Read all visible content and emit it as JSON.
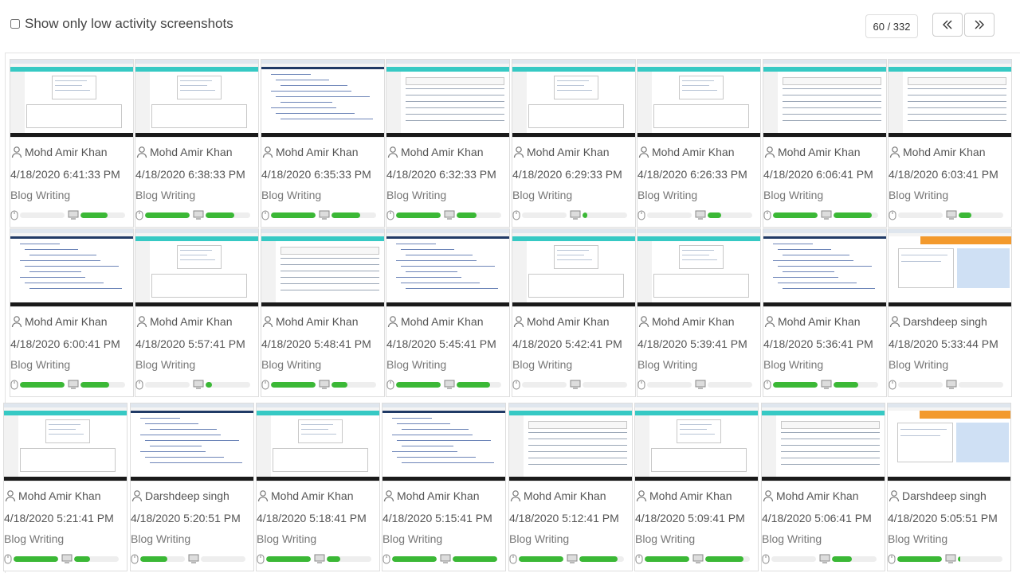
{
  "header": {
    "low_activity_label": "Show only low activity screenshots",
    "low_activity_checked": false,
    "pager_text": "60 / 332",
    "prev_icon": "double-chevron-left-icon",
    "next_icon": "double-chevron-right-icon"
  },
  "colors": {
    "activity_bar": "#3bb836",
    "teal": "#36c9c4",
    "track": "#eeeeee"
  },
  "screenshots": [
    {
      "user": "Mohd Amir Khan",
      "time": "4/18/2020 6:41:33 PM",
      "project": "Blog Writing",
      "mouse": 0.0,
      "keyboard": 0.6,
      "thumb": "web"
    },
    {
      "user": "Mohd Amir Khan",
      "time": "4/18/2020 6:38:33 PM",
      "project": "Blog Writing",
      "mouse": 1.0,
      "keyboard": 0.65,
      "thumb": "web"
    },
    {
      "user": "Mohd Amir Khan",
      "time": "4/18/2020 6:35:33 PM",
      "project": "Blog Writing",
      "mouse": 1.0,
      "keyboard": 0.65,
      "thumb": "code"
    },
    {
      "user": "Mohd Amir Khan",
      "time": "4/18/2020 6:32:33 PM",
      "project": "Blog Writing",
      "mouse": 1.0,
      "keyboard": 0.45,
      "thumb": "table"
    },
    {
      "user": "Mohd Amir Khan",
      "time": "4/18/2020 6:29:33 PM",
      "project": "Blog Writing",
      "mouse": 0.0,
      "keyboard": 0.1,
      "thumb": "web"
    },
    {
      "user": "Mohd Amir Khan",
      "time": "4/18/2020 6:26:33 PM",
      "project": "Blog Writing",
      "mouse": 0.0,
      "keyboard": 0.3,
      "thumb": "web"
    },
    {
      "user": "Mohd Amir Khan",
      "time": "4/18/2020 6:06:41 PM",
      "project": "Blog Writing",
      "mouse": 1.0,
      "keyboard": 0.85,
      "thumb": "table"
    },
    {
      "user": "Mohd Amir Khan",
      "time": "4/18/2020 6:03:41 PM",
      "project": "Blog Writing",
      "mouse": 0.0,
      "keyboard": 0.28,
      "thumb": "table"
    },
    {
      "user": "Mohd Amir Khan",
      "time": "4/18/2020 6:00:41 PM",
      "project": "Blog Writing",
      "mouse": 1.0,
      "keyboard": 0.65,
      "thumb": "code"
    },
    {
      "user": "Mohd Amir Khan",
      "time": "4/18/2020 5:57:41 PM",
      "project": "Blog Writing",
      "mouse": 0.0,
      "keyboard": 0.15,
      "thumb": "web"
    },
    {
      "user": "Mohd Amir Khan",
      "time": "4/18/2020 5:48:41 PM",
      "project": "Blog Writing",
      "mouse": 1.0,
      "keyboard": 0.35,
      "thumb": "table"
    },
    {
      "user": "Mohd Amir Khan",
      "time": "4/18/2020 5:45:41 PM",
      "project": "Blog Writing",
      "mouse": 1.0,
      "keyboard": 0.75,
      "thumb": "code"
    },
    {
      "user": "Mohd Amir Khan",
      "time": "4/18/2020 5:42:41 PM",
      "project": "Blog Writing",
      "mouse": 0.0,
      "keyboard": 0.0,
      "thumb": "web"
    },
    {
      "user": "Mohd Amir Khan",
      "time": "4/18/2020 5:39:41 PM",
      "project": "Blog Writing",
      "mouse": 0.0,
      "keyboard": 0.0,
      "thumb": "web"
    },
    {
      "user": "Mohd Amir Khan",
      "time": "4/18/2020 5:36:41 PM",
      "project": "Blog Writing",
      "mouse": 1.0,
      "keyboard": 0.55,
      "thumb": "code"
    },
    {
      "user": "Darshdeep singh",
      "time": "4/18/2020 5:33:44 PM",
      "project": "Blog Writing",
      "mouse": 0.0,
      "keyboard": 0.0,
      "thumb": "orange"
    },
    {
      "user": "Mohd Amir Khan",
      "time": "4/18/2020 5:21:41 PM",
      "project": "Blog Writing",
      "mouse": 1.0,
      "keyboard": 0.35,
      "thumb": "web"
    },
    {
      "user": "Darshdeep singh",
      "time": "4/18/2020 5:20:51 PM",
      "project": "Blog Writing",
      "mouse": 0.6,
      "keyboard": 0.0,
      "thumb": "code"
    },
    {
      "user": "Mohd Amir Khan",
      "time": "4/18/2020 5:18:41 PM",
      "project": "Blog Writing",
      "mouse": 1.0,
      "keyboard": 0.3,
      "thumb": "web"
    },
    {
      "user": "Mohd Amir Khan",
      "time": "4/18/2020 5:15:41 PM",
      "project": "Blog Writing",
      "mouse": 1.0,
      "keyboard": 1.0,
      "thumb": "code"
    },
    {
      "user": "Mohd Amir Khan",
      "time": "4/18/2020 5:12:41 PM",
      "project": "Blog Writing",
      "mouse": 1.0,
      "keyboard": 0.85,
      "thumb": "table"
    },
    {
      "user": "Mohd Amir Khan",
      "time": "4/18/2020 5:09:41 PM",
      "project": "Blog Writing",
      "mouse": 1.0,
      "keyboard": 0.85,
      "thumb": "web"
    },
    {
      "user": "Mohd Amir Khan",
      "time": "4/18/2020 5:06:41 PM",
      "project": "Blog Writing",
      "mouse": 0.0,
      "keyboard": 0.45,
      "thumb": "table"
    },
    {
      "user": "Darshdeep singh",
      "time": "4/18/2020 5:05:51 PM",
      "project": "Blog Writing",
      "mouse": 1.0,
      "keyboard": 0.05,
      "thumb": "orange"
    }
  ]
}
